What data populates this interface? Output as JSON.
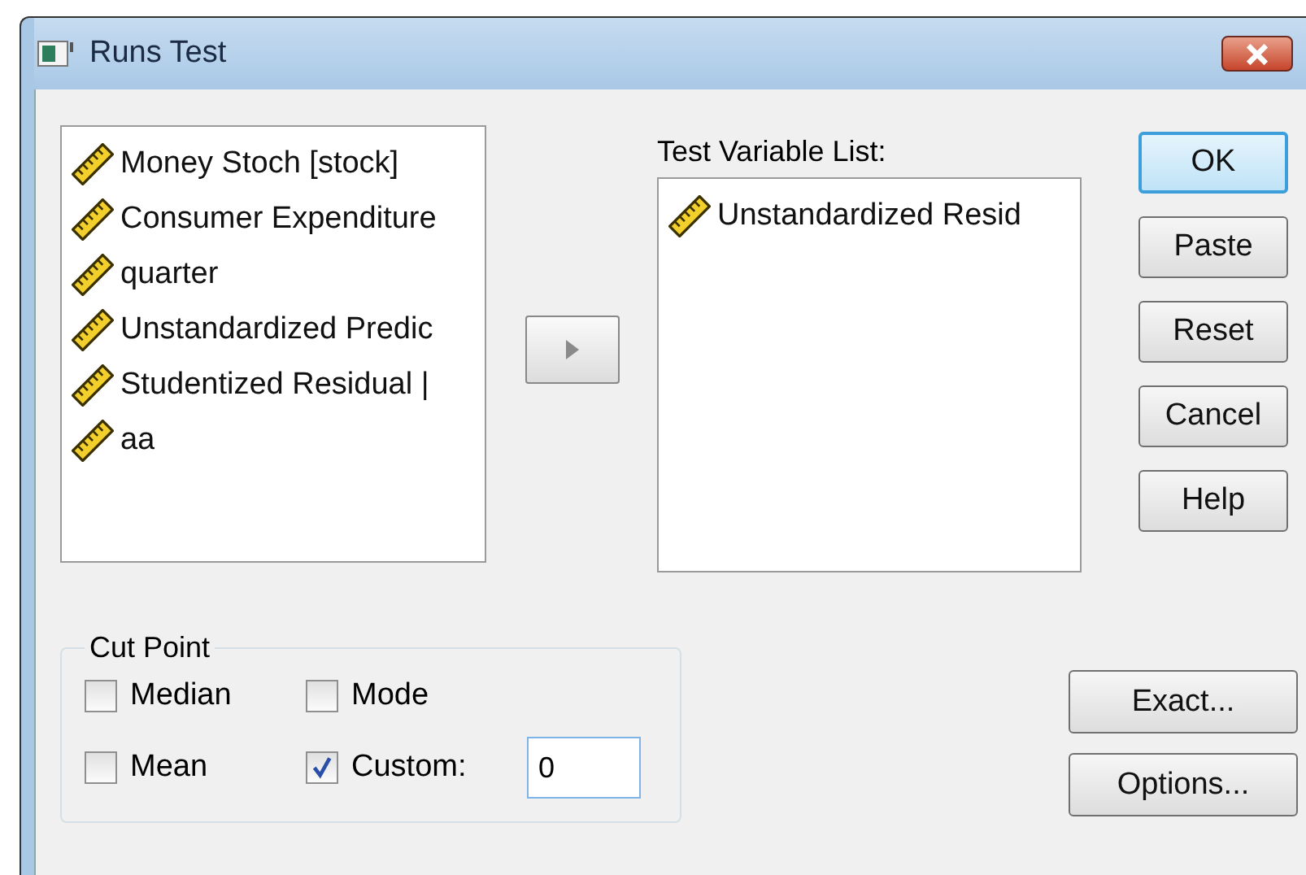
{
  "window": {
    "title": "Runs Test"
  },
  "source_list": {
    "items": [
      {
        "label": "Money Stoch [stock]"
      },
      {
        "label": "Consumer Expenditure"
      },
      {
        "label": "quarter"
      },
      {
        "label": "Unstandardized Predic"
      },
      {
        "label": "Studentized Residual |"
      },
      {
        "label": "aa"
      }
    ]
  },
  "test_variable_list": {
    "label": "Test Variable List:",
    "items": [
      {
        "label": "Unstandardized Resid"
      }
    ]
  },
  "buttons": [
    {
      "label": "OK",
      "default": true
    },
    {
      "label": "Paste",
      "default": false
    },
    {
      "label": "Reset",
      "default": false
    },
    {
      "label": "Cancel",
      "default": false
    },
    {
      "label": "Help",
      "default": false
    }
  ],
  "cut_point": {
    "title": "Cut Point",
    "options": [
      {
        "label": "Median",
        "checked": false
      },
      {
        "label": "Mode",
        "checked": false
      },
      {
        "label": "Mean",
        "checked": false
      },
      {
        "label": "Custom:",
        "checked": true,
        "value": "0"
      }
    ]
  },
  "side_buttons": [
    {
      "label": "Exact..."
    },
    {
      "label": "Options..."
    }
  ]
}
